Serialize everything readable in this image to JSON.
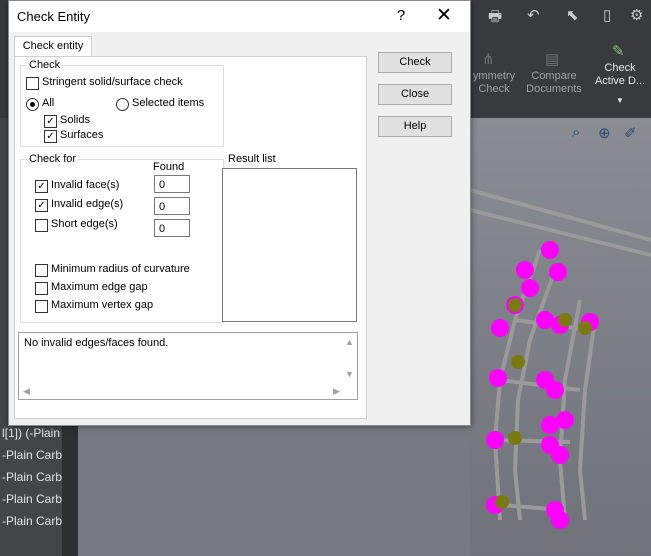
{
  "app": {
    "toolbar": {
      "symmetry_check": "ymmetry\nCheck",
      "compare_documents": "Compare\nDocuments",
      "check_active_doc": "Check\nActive D..."
    },
    "tree_rows": [
      "l[1]) (-Plain",
      "-Plain Carbo",
      "-Plain Carbo",
      "-Plain Carbo",
      "-Plain Carbo",
      "-Plain Carbo"
    ]
  },
  "dialog": {
    "title": "Check Entity",
    "help_button": "?",
    "close_icon": "✕",
    "tab": "Check entity",
    "check_group": {
      "title": "Check",
      "stringent_label": "Stringent solid/surface check",
      "stringent_checked": false,
      "all_label": "All",
      "selected_items_label": "Selected items",
      "selected_option": "All",
      "solids_label": "Solids",
      "solids_checked": true,
      "surfaces_label": "Surfaces",
      "surfaces_checked": true
    },
    "check_for_group": {
      "title": "Check for",
      "found_header": "Found",
      "items": [
        {
          "label": "Invalid face(s)",
          "checked": true,
          "found": "0"
        },
        {
          "label": "Invalid edge(s)",
          "checked": true,
          "found": "0"
        },
        {
          "label": "Short edge(s)",
          "checked": false,
          "found": "0"
        }
      ],
      "extra_items": [
        {
          "label": "Minimum radius of curvature",
          "checked": false
        },
        {
          "label": "Maximum edge gap",
          "checked": false
        },
        {
          "label": "Maximum vertex gap",
          "checked": false
        }
      ]
    },
    "result_list_label": "Result list",
    "message": "No invalid edges/faces found.",
    "buttons": {
      "check": "Check",
      "close": "Close",
      "help": "Help"
    }
  }
}
